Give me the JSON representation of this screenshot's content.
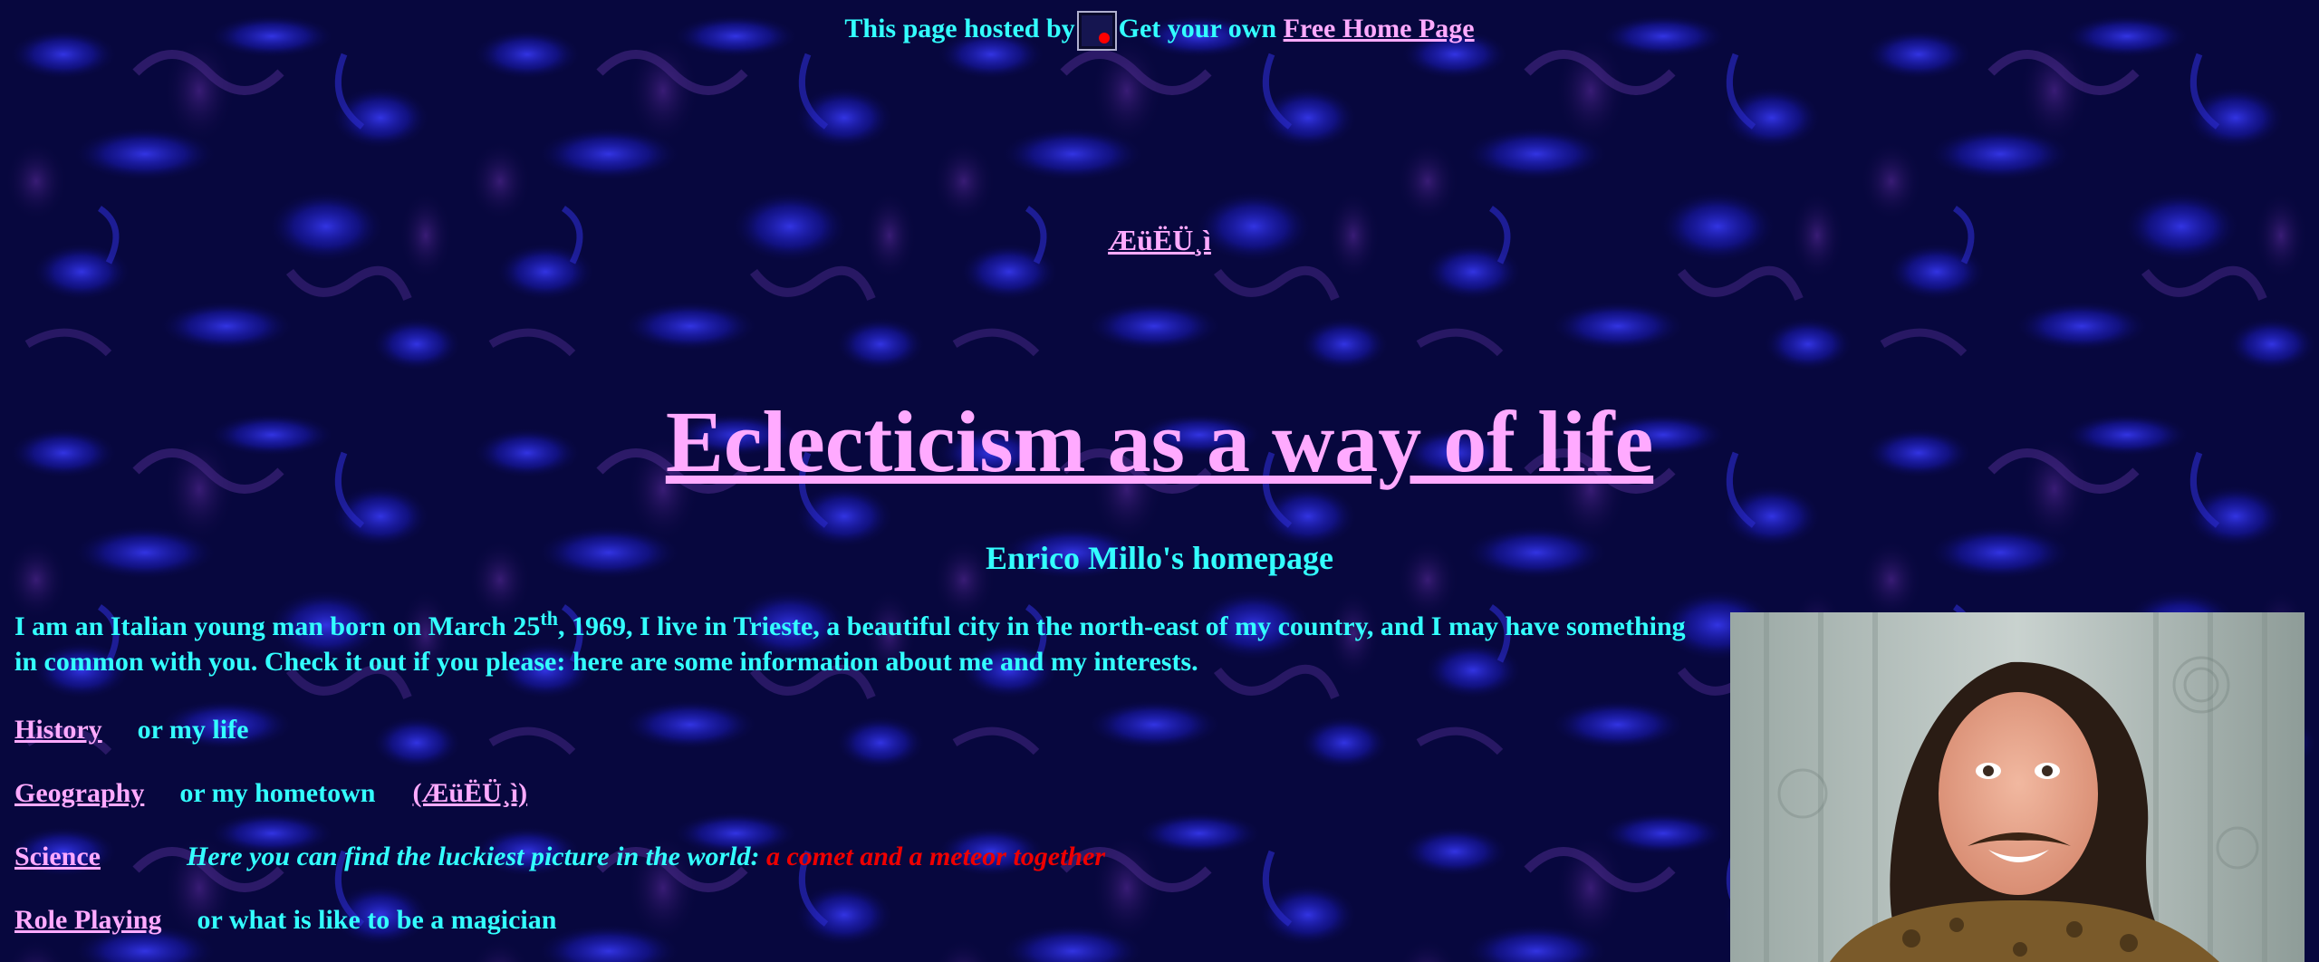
{
  "host_bar": {
    "text": "This page hosted by",
    "get_own": "Get your own",
    "free_home_page": "Free Home Page"
  },
  "encoded_link": "ÆüËÜ¸ì",
  "title": "Eclecticism as a way of life",
  "subtitle": "Enrico Millo's homepage",
  "intro": {
    "part1": "I am an Italian young man born on March 25",
    "sup": "th",
    "part2": ", 1969, I live in Trieste, a beautiful city in the north-east of my country, and I may have something in common with you. Check it out if you please: here are some information about me and my interests."
  },
  "menu": [
    {
      "link": "History",
      "desc": "or my life"
    },
    {
      "link": "Geography",
      "desc": "or my hometown",
      "extra_link": "(ÆüËÜ¸ì)"
    },
    {
      "link": "Science",
      "desc": "Here you can find the luckiest picture in the world:",
      "desc_red": "a comet and a meteor together"
    },
    {
      "link": "Role Playing",
      "desc": "or what is like to be a magician"
    }
  ],
  "colors": {
    "background": "#06063a",
    "text": "#33ffff",
    "link": "#ffaaff",
    "highlight": "#ee0000"
  }
}
